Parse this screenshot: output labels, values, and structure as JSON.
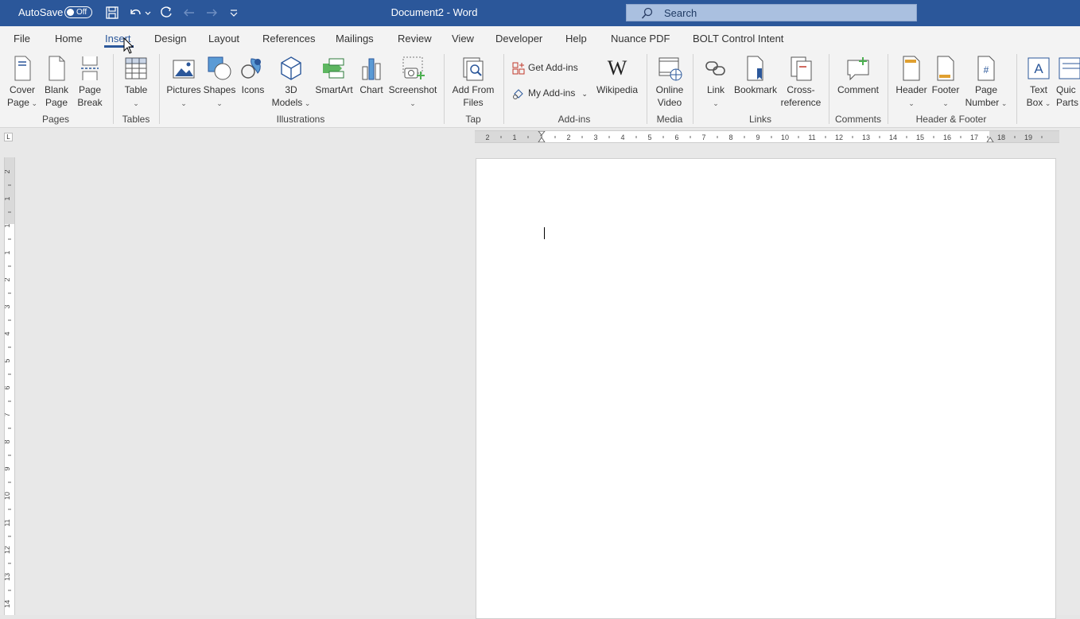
{
  "titlebar": {
    "autosave_label": "AutoSave",
    "autosave_state": "Off",
    "doc_title": "Document2  -  Word",
    "search_placeholder": "Search"
  },
  "tabs": [
    "File",
    "Home",
    "Insert",
    "Design",
    "Layout",
    "References",
    "Mailings",
    "Review",
    "View",
    "Developer",
    "Help",
    "Nuance PDF",
    "BOLT Control Intent"
  ],
  "active_tab": "Insert",
  "ribbon": {
    "pages": {
      "group": "Pages",
      "cover_page": [
        "Cover",
        "Page"
      ],
      "blank_page": [
        "Blank",
        "Page"
      ],
      "page_break": [
        "Page",
        "Break"
      ]
    },
    "tables": {
      "group": "Tables",
      "table": "Table"
    },
    "illustrations": {
      "group": "Illustrations",
      "pictures": "Pictures",
      "shapes": "Shapes",
      "icons": "Icons",
      "models": [
        "3D",
        "Models"
      ],
      "smartart": "SmartArt",
      "chart": "Chart",
      "screenshot": "Screenshot"
    },
    "tap": {
      "group": "Tap",
      "add_from_files": [
        "Add From",
        "Files"
      ]
    },
    "addins": {
      "group": "Add-ins",
      "get_addins": "Get Add-ins",
      "my_addins": "My Add-ins",
      "wikipedia": "Wikipedia"
    },
    "media": {
      "group": "Media",
      "online_video": [
        "Online",
        "Video"
      ]
    },
    "links": {
      "group": "Links",
      "link": "Link",
      "bookmark": "Bookmark",
      "cross_reference": [
        "Cross-",
        "reference"
      ]
    },
    "comments": {
      "group": "Comments",
      "comment": "Comment"
    },
    "header_footer": {
      "group": "Header & Footer",
      "header": "Header",
      "footer": "Footer",
      "page_number": [
        "Page",
        "Number"
      ]
    },
    "text": {
      "text_box": [
        "Text",
        "Box"
      ],
      "quick_parts": [
        "Quic",
        "Parts"
      ]
    }
  },
  "ruler": {
    "corner": "L",
    "h_labels": [
      "2",
      "1",
      "1",
      "2",
      "3",
      "4",
      "5",
      "6",
      "7",
      "8",
      "9",
      "10",
      "11",
      "12",
      "13",
      "14",
      "15",
      "16",
      "17",
      "18",
      "19"
    ],
    "v_labels": [
      "2",
      "1",
      "1",
      "1",
      "2",
      "3",
      "4",
      "5",
      "6",
      "7",
      "8",
      "9",
      "10",
      "11",
      "12",
      "13",
      "14"
    ]
  }
}
